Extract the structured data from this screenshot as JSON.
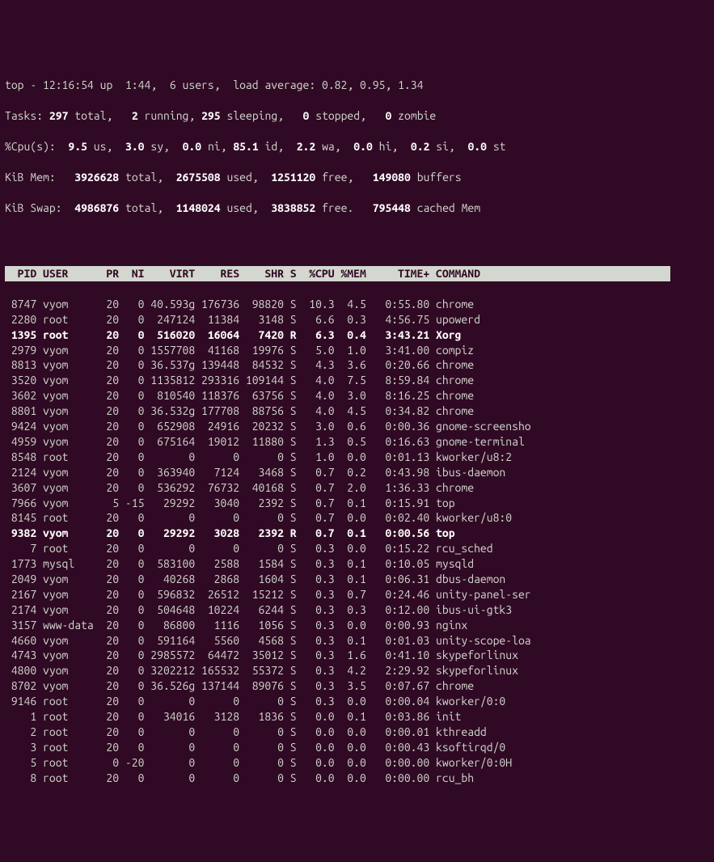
{
  "summary": {
    "line1_a": "top - 12:16:54 up  1:44,  6 users,  load average: 0.82, 0.95, 1.34",
    "tasks_prefix": "Tasks: ",
    "tasks_total": "297 ",
    "tasks_total_lbl": "total,   ",
    "tasks_running": "2 ",
    "tasks_running_lbl": "running, ",
    "tasks_sleeping": "295 ",
    "tasks_sleeping_lbl": "sleeping,   ",
    "tasks_stopped": "0 ",
    "tasks_stopped_lbl": "stopped,   ",
    "tasks_zombie": "0 ",
    "tasks_zombie_lbl": "zombie",
    "cpu_prefix": "%Cpu(s):  ",
    "cpu_us": "9.5 ",
    "cpu_us_lbl": "us,  ",
    "cpu_sy": "3.0 ",
    "cpu_sy_lbl": "sy,  ",
    "cpu_ni": "0.0 ",
    "cpu_ni_lbl": "ni, ",
    "cpu_id": "85.1 ",
    "cpu_id_lbl": "id,  ",
    "cpu_wa": "2.2 ",
    "cpu_wa_lbl": "wa,  ",
    "cpu_hi": "0.0 ",
    "cpu_hi_lbl": "hi,  ",
    "cpu_si": "0.2 ",
    "cpu_si_lbl": "si,  ",
    "cpu_st": "0.0 ",
    "cpu_st_lbl": "st",
    "mem_prefix": "KiB Mem:   ",
    "mem_total": "3926628 ",
    "mem_total_lbl": "total,  ",
    "mem_used": "2675508 ",
    "mem_used_lbl": "used,  ",
    "mem_free": "1251120 ",
    "mem_free_lbl": "free,   ",
    "mem_buf": "149080 ",
    "mem_buf_lbl": "buffers",
    "swap_prefix": "KiB Swap:  ",
    "swap_total": "4986876 ",
    "swap_total_lbl": "total,  ",
    "swap_used": "1148024 ",
    "swap_used_lbl": "used,  ",
    "swap_free": "3838852 ",
    "swap_free_lbl": "free.   ",
    "swap_cache": "795448 ",
    "swap_cache_lbl": "cached Mem"
  },
  "columns": {
    "pid": "PID",
    "user": "USER",
    "pr": "PR",
    "ni": "NI",
    "virt": "VIRT",
    "res": "RES",
    "shr": "SHR",
    "s": "S",
    "cpu": "%CPU",
    "mem": "%MEM",
    "time": "TIME+",
    "cmd": "COMMAND"
  },
  "processes": [
    {
      "pid": "8747",
      "user": "vyom",
      "pr": "20",
      "ni": "0",
      "virt": "40.593g",
      "res": "176736",
      "shr": "98820",
      "s": "S",
      "cpu": "10.3",
      "mem": "4.5",
      "time": "0:55.80",
      "cmd": "chrome",
      "bold": false
    },
    {
      "pid": "2280",
      "user": "root",
      "pr": "20",
      "ni": "0",
      "virt": "247124",
      "res": "11384",
      "shr": "3148",
      "s": "S",
      "cpu": "6.6",
      "mem": "0.3",
      "time": "4:56.75",
      "cmd": "upowerd",
      "bold": false
    },
    {
      "pid": "1395",
      "user": "root",
      "pr": "20",
      "ni": "0",
      "virt": "516020",
      "res": "16064",
      "shr": "7420",
      "s": "R",
      "cpu": "6.3",
      "mem": "0.4",
      "time": "3:43.21",
      "cmd": "Xorg",
      "bold": true
    },
    {
      "pid": "2979",
      "user": "vyom",
      "pr": "20",
      "ni": "0",
      "virt": "1557708",
      "res": "41168",
      "shr": "19976",
      "s": "S",
      "cpu": "5.0",
      "mem": "1.0",
      "time": "3:41.00",
      "cmd": "compiz",
      "bold": false
    },
    {
      "pid": "8813",
      "user": "vyom",
      "pr": "20",
      "ni": "0",
      "virt": "36.537g",
      "res": "139448",
      "shr": "84532",
      "s": "S",
      "cpu": "4.3",
      "mem": "3.6",
      "time": "0:20.66",
      "cmd": "chrome",
      "bold": false
    },
    {
      "pid": "3520",
      "user": "vyom",
      "pr": "20",
      "ni": "0",
      "virt": "1135812",
      "res": "293316",
      "shr": "109144",
      "s": "S",
      "cpu": "4.0",
      "mem": "7.5",
      "time": "8:59.84",
      "cmd": "chrome",
      "bold": false
    },
    {
      "pid": "3602",
      "user": "vyom",
      "pr": "20",
      "ni": "0",
      "virt": "810540",
      "res": "118376",
      "shr": "63756",
      "s": "S",
      "cpu": "4.0",
      "mem": "3.0",
      "time": "8:16.25",
      "cmd": "chrome",
      "bold": false
    },
    {
      "pid": "8801",
      "user": "vyom",
      "pr": "20",
      "ni": "0",
      "virt": "36.532g",
      "res": "177708",
      "shr": "88756",
      "s": "S",
      "cpu": "4.0",
      "mem": "4.5",
      "time": "0:34.82",
      "cmd": "chrome",
      "bold": false
    },
    {
      "pid": "9424",
      "user": "vyom",
      "pr": "20",
      "ni": "0",
      "virt": "652908",
      "res": "24916",
      "shr": "20232",
      "s": "S",
      "cpu": "3.0",
      "mem": "0.6",
      "time": "0:00.36",
      "cmd": "gnome-screensho",
      "bold": false
    },
    {
      "pid": "4959",
      "user": "vyom",
      "pr": "20",
      "ni": "0",
      "virt": "675164",
      "res": "19012",
      "shr": "11880",
      "s": "S",
      "cpu": "1.3",
      "mem": "0.5",
      "time": "0:16.63",
      "cmd": "gnome-terminal",
      "bold": false
    },
    {
      "pid": "8548",
      "user": "root",
      "pr": "20",
      "ni": "0",
      "virt": "0",
      "res": "0",
      "shr": "0",
      "s": "S",
      "cpu": "1.0",
      "mem": "0.0",
      "time": "0:01.13",
      "cmd": "kworker/u8:2",
      "bold": false
    },
    {
      "pid": "2124",
      "user": "vyom",
      "pr": "20",
      "ni": "0",
      "virt": "363940",
      "res": "7124",
      "shr": "3468",
      "s": "S",
      "cpu": "0.7",
      "mem": "0.2",
      "time": "0:43.98",
      "cmd": "ibus-daemon",
      "bold": false
    },
    {
      "pid": "3607",
      "user": "vyom",
      "pr": "20",
      "ni": "0",
      "virt": "536292",
      "res": "76732",
      "shr": "40168",
      "s": "S",
      "cpu": "0.7",
      "mem": "2.0",
      "time": "1:36.33",
      "cmd": "chrome",
      "bold": false
    },
    {
      "pid": "7966",
      "user": "vyom",
      "pr": "5",
      "ni": "-15",
      "virt": "29292",
      "res": "3040",
      "shr": "2392",
      "s": "S",
      "cpu": "0.7",
      "mem": "0.1",
      "time": "0:15.91",
      "cmd": "top",
      "bold": false
    },
    {
      "pid": "8145",
      "user": "root",
      "pr": "20",
      "ni": "0",
      "virt": "0",
      "res": "0",
      "shr": "0",
      "s": "S",
      "cpu": "0.7",
      "mem": "0.0",
      "time": "0:02.40",
      "cmd": "kworker/u8:0",
      "bold": false
    },
    {
      "pid": "9382",
      "user": "vyom",
      "pr": "20",
      "ni": "0",
      "virt": "29292",
      "res": "3028",
      "shr": "2392",
      "s": "R",
      "cpu": "0.7",
      "mem": "0.1",
      "time": "0:00.56",
      "cmd": "top",
      "bold": true
    },
    {
      "pid": "7",
      "user": "root",
      "pr": "20",
      "ni": "0",
      "virt": "0",
      "res": "0",
      "shr": "0",
      "s": "S",
      "cpu": "0.3",
      "mem": "0.0",
      "time": "0:15.22",
      "cmd": "rcu_sched",
      "bold": false
    },
    {
      "pid": "1773",
      "user": "mysql",
      "pr": "20",
      "ni": "0",
      "virt": "583100",
      "res": "2588",
      "shr": "1584",
      "s": "S",
      "cpu": "0.3",
      "mem": "0.1",
      "time": "0:10.05",
      "cmd": "mysqld",
      "bold": false
    },
    {
      "pid": "2049",
      "user": "vyom",
      "pr": "20",
      "ni": "0",
      "virt": "40268",
      "res": "2868",
      "shr": "1604",
      "s": "S",
      "cpu": "0.3",
      "mem": "0.1",
      "time": "0:06.31",
      "cmd": "dbus-daemon",
      "bold": false
    },
    {
      "pid": "2167",
      "user": "vyom",
      "pr": "20",
      "ni": "0",
      "virt": "596832",
      "res": "26512",
      "shr": "15212",
      "s": "S",
      "cpu": "0.3",
      "mem": "0.7",
      "time": "0:24.46",
      "cmd": "unity-panel-ser",
      "bold": false
    },
    {
      "pid": "2174",
      "user": "vyom",
      "pr": "20",
      "ni": "0",
      "virt": "504648",
      "res": "10224",
      "shr": "6244",
      "s": "S",
      "cpu": "0.3",
      "mem": "0.3",
      "time": "0:12.00",
      "cmd": "ibus-ui-gtk3",
      "bold": false
    },
    {
      "pid": "3157",
      "user": "www-data",
      "pr": "20",
      "ni": "0",
      "virt": "86800",
      "res": "1116",
      "shr": "1056",
      "s": "S",
      "cpu": "0.3",
      "mem": "0.0",
      "time": "0:00.93",
      "cmd": "nginx",
      "bold": false
    },
    {
      "pid": "4660",
      "user": "vyom",
      "pr": "20",
      "ni": "0",
      "virt": "591164",
      "res": "5560",
      "shr": "4568",
      "s": "S",
      "cpu": "0.3",
      "mem": "0.1",
      "time": "0:01.03",
      "cmd": "unity-scope-loa",
      "bold": false
    },
    {
      "pid": "4743",
      "user": "vyom",
      "pr": "20",
      "ni": "0",
      "virt": "2985572",
      "res": "64472",
      "shr": "35012",
      "s": "S",
      "cpu": "0.3",
      "mem": "1.6",
      "time": "0:41.10",
      "cmd": "skypeforlinux",
      "bold": false
    },
    {
      "pid": "4800",
      "user": "vyom",
      "pr": "20",
      "ni": "0",
      "virt": "3202212",
      "res": "165532",
      "shr": "55372",
      "s": "S",
      "cpu": "0.3",
      "mem": "4.2",
      "time": "2:29.92",
      "cmd": "skypeforlinux",
      "bold": false
    },
    {
      "pid": "8702",
      "user": "vyom",
      "pr": "20",
      "ni": "0",
      "virt": "36.526g",
      "res": "137144",
      "shr": "89076",
      "s": "S",
      "cpu": "0.3",
      "mem": "3.5",
      "time": "0:07.67",
      "cmd": "chrome",
      "bold": false
    },
    {
      "pid": "9146",
      "user": "root",
      "pr": "20",
      "ni": "0",
      "virt": "0",
      "res": "0",
      "shr": "0",
      "s": "S",
      "cpu": "0.3",
      "mem": "0.0",
      "time": "0:00.04",
      "cmd": "kworker/0:0",
      "bold": false
    },
    {
      "pid": "1",
      "user": "root",
      "pr": "20",
      "ni": "0",
      "virt": "34016",
      "res": "3128",
      "shr": "1836",
      "s": "S",
      "cpu": "0.0",
      "mem": "0.1",
      "time": "0:03.86",
      "cmd": "init",
      "bold": false
    },
    {
      "pid": "2",
      "user": "root",
      "pr": "20",
      "ni": "0",
      "virt": "0",
      "res": "0",
      "shr": "0",
      "s": "S",
      "cpu": "0.0",
      "mem": "0.0",
      "time": "0:00.01",
      "cmd": "kthreadd",
      "bold": false
    },
    {
      "pid": "3",
      "user": "root",
      "pr": "20",
      "ni": "0",
      "virt": "0",
      "res": "0",
      "shr": "0",
      "s": "S",
      "cpu": "0.0",
      "mem": "0.0",
      "time": "0:00.43",
      "cmd": "ksoftirqd/0",
      "bold": false
    },
    {
      "pid": "5",
      "user": "root",
      "pr": "0",
      "ni": "-20",
      "virt": "0",
      "res": "0",
      "shr": "0",
      "s": "S",
      "cpu": "0.0",
      "mem": "0.0",
      "time": "0:00.00",
      "cmd": "kworker/0:0H",
      "bold": false
    },
    {
      "pid": "8",
      "user": "root",
      "pr": "20",
      "ni": "0",
      "virt": "0",
      "res": "0",
      "shr": "0",
      "s": "S",
      "cpu": "0.0",
      "mem": "0.0",
      "time": "0:00.00",
      "cmd": "rcu_bh",
      "bold": false
    }
  ]
}
